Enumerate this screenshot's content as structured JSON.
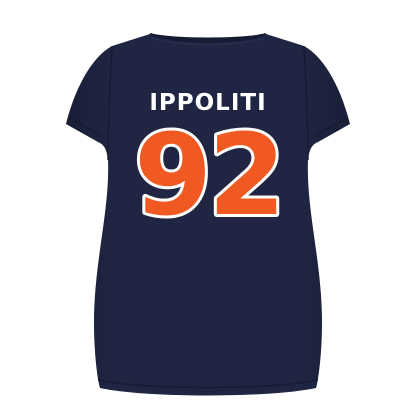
{
  "product": {
    "garment": "t-shirt-back",
    "name": "IPPOLITI",
    "number": "92"
  },
  "colors": {
    "background": "#ffffff",
    "shirt": "#1f2543",
    "shirt_shadow": "#161b33",
    "name_text": "#ffffff",
    "number_fill": "#f05a22",
    "number_outline": "#ffffff"
  }
}
